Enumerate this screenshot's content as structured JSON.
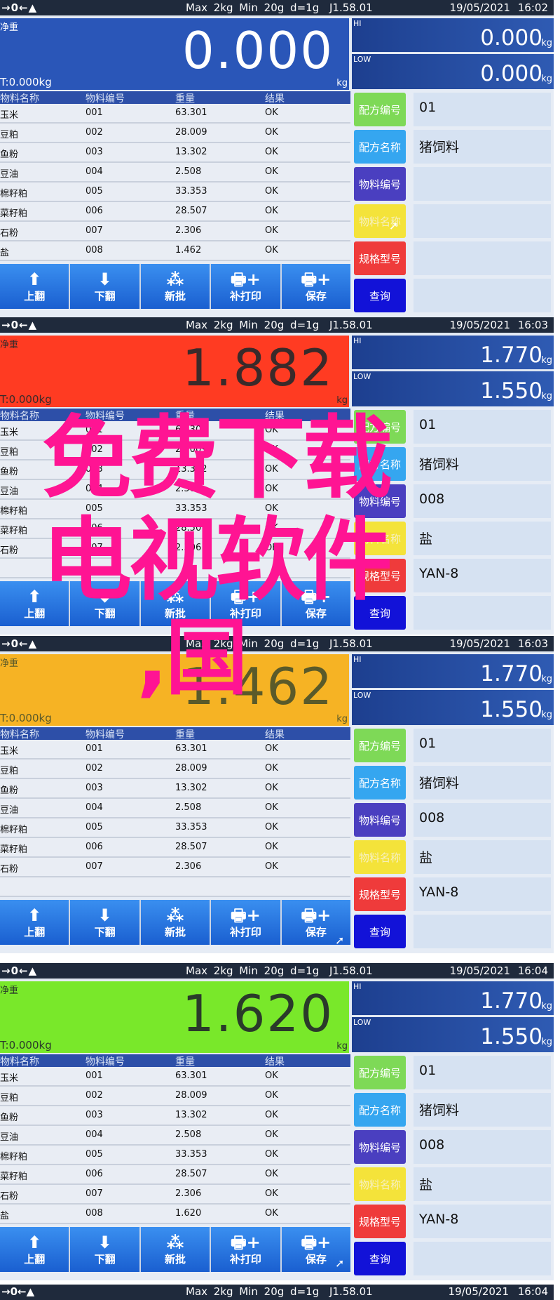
{
  "status_bar": {
    "icons_text": "→0←▲",
    "spec": "Max 2kg  Min 20g  d=1g",
    "version": "J1.58.01",
    "date": "19/05/2021"
  },
  "labels": {
    "net": "净重",
    "tare": "T:0.000kg",
    "unit": "kg",
    "hi": "HI",
    "low": "LOW"
  },
  "table": {
    "headers": [
      "物料名称",
      "物料编号",
      "重量",
      "结果"
    ]
  },
  "buttons": [
    "上翻",
    "下翻",
    "新批",
    "补打印",
    "保存"
  ],
  "side_buttons": [
    {
      "label": "配方编号",
      "color": "#7ed957"
    },
    {
      "label": "配方名称",
      "color": "#35a6f0"
    },
    {
      "label": "物料编号",
      "color": "#4a3fc0"
    },
    {
      "label": "物料名称",
      "color": "#f4e33a"
    },
    {
      "label": "规格型号",
      "color": "#ef3b3b"
    },
    {
      "label": "查询",
      "color": "#1212d8"
    }
  ],
  "screens": [
    {
      "time": "16:02",
      "weight": "0.000",
      "display_color": "#2a56b8",
      "value_color": "#ffffff",
      "hi": "0.000",
      "low": "0.000",
      "rows": [
        [
          "玉米",
          "001",
          "63.301",
          "OK"
        ],
        [
          "豆粕",
          "002",
          "28.009",
          "OK"
        ],
        [
          "鱼粉",
          "003",
          "13.302",
          "OK"
        ],
        [
          "豆油",
          "004",
          "2.508",
          "OK"
        ],
        [
          "棉籽粕",
          "005",
          "33.353",
          "OK"
        ],
        [
          "菜籽粕",
          "006",
          "28.507",
          "OK"
        ],
        [
          "石粉",
          "007",
          "2.306",
          "OK"
        ],
        [
          "盐",
          "008",
          "1.462",
          "OK"
        ]
      ],
      "fields": [
        "01",
        "猪饲料",
        "",
        "",
        "",
        ""
      ]
    },
    {
      "time": "16:03",
      "weight": "1.882",
      "display_color": "#ff3b22",
      "value_color": "#3a2a2a",
      "hi": "1.770",
      "low": "1.550",
      "rows": [
        [
          "玉米",
          "001",
          "63.301",
          "OK"
        ],
        [
          "豆粕",
          "002",
          "28.009",
          "OK"
        ],
        [
          "鱼粉",
          "003",
          "13.302",
          "OK"
        ],
        [
          "豆油",
          "004",
          "2.508",
          "OK"
        ],
        [
          "棉籽粕",
          "005",
          "33.353",
          "OK"
        ],
        [
          "菜籽粕",
          "006",
          "28.507",
          "OK"
        ],
        [
          "石粉",
          "007",
          "2.306",
          "OK"
        ],
        [
          "",
          "",
          "",
          ""
        ]
      ],
      "fields": [
        "01",
        "猪饲料",
        "008",
        "盐",
        "YAN-8",
        ""
      ]
    },
    {
      "time": "16:03",
      "weight": "1.462",
      "display_color": "#f6b324",
      "value_color": "#5a5a2a",
      "hi": "1.770",
      "low": "1.550",
      "rows": [
        [
          "玉米",
          "001",
          "63.301",
          "OK"
        ],
        [
          "豆粕",
          "002",
          "28.009",
          "OK"
        ],
        [
          "鱼粉",
          "003",
          "13.302",
          "OK"
        ],
        [
          "豆油",
          "004",
          "2.508",
          "OK"
        ],
        [
          "棉籽粕",
          "005",
          "33.353",
          "OK"
        ],
        [
          "菜籽粕",
          "006",
          "28.507",
          "OK"
        ],
        [
          "石粉",
          "007",
          "2.306",
          "OK"
        ],
        [
          "",
          "",
          "",
          ""
        ]
      ],
      "fields": [
        "01",
        "猪饲料",
        "008",
        "盐",
        "YAN-8",
        ""
      ]
    },
    {
      "time": "16:04",
      "weight": "1.620",
      "display_color": "#79e82a",
      "value_color": "#2a3a2a",
      "hi": "1.770",
      "low": "1.550",
      "rows": [
        [
          "玉米",
          "001",
          "63.301",
          "OK"
        ],
        [
          "豆粕",
          "002",
          "28.009",
          "OK"
        ],
        [
          "鱼粉",
          "003",
          "13.302",
          "OK"
        ],
        [
          "豆油",
          "004",
          "2.508",
          "OK"
        ],
        [
          "棉籽粕",
          "005",
          "33.353",
          "OK"
        ],
        [
          "菜籽粕",
          "006",
          "28.507",
          "OK"
        ],
        [
          "石粉",
          "007",
          "2.306",
          "OK"
        ],
        [
          "盐",
          "008",
          "1.620",
          "OK"
        ]
      ],
      "fields": [
        "01",
        "猪饲料",
        "008",
        "盐",
        "YAN-8",
        ""
      ]
    }
  ],
  "final_bar": {
    "time": "16:04"
  },
  "watermark": {
    "line1": "免费下载",
    "line2": "电视软件",
    "line3": ",国",
    "color": "#ff1493"
  }
}
